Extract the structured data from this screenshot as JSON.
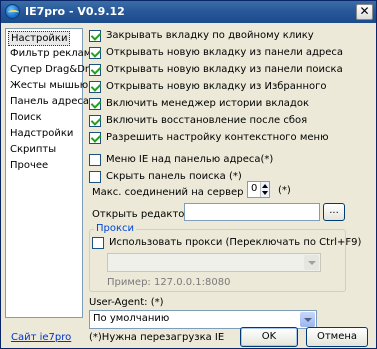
{
  "window": {
    "title": "IE7pro - V0.9.12",
    "close_symbol": "✕"
  },
  "sidebar": {
    "items": [
      {
        "label": "Настройки",
        "selected": true
      },
      {
        "label": "Фильтр рекламы"
      },
      {
        "label": "Супер Drag&Drop"
      },
      {
        "label": "Жесты мышью"
      },
      {
        "label": "Панель адреса"
      },
      {
        "label": "Поиск"
      },
      {
        "label": "Надстройки"
      },
      {
        "label": "Скрипты"
      },
      {
        "label": "Прочее"
      }
    ]
  },
  "options": {
    "close_dblclick": "Закрывать вкладку по двойному клику",
    "new_tab_address": "Открывать новую вкладку из панели адреса",
    "new_tab_search": "Открывать новую вкладку из панели поиска",
    "new_tab_favorites": "Открывать новую вкладку из Избранного",
    "history_manager": "Включить менеджер истории вкладок",
    "crash_recovery": "Включить восстановление после сбоя",
    "context_menu": "Разрешить настройку контекстного меню",
    "ie_menu_above": "Меню IE над панелью адреса(*)",
    "hide_search": "Скрыть панель поиска (*)"
  },
  "connections": {
    "label": "Макс. соединений на сервер",
    "value": "0",
    "suffix": "(*)"
  },
  "editor": {
    "label": "Открыть редактор",
    "value": "",
    "browse": "..."
  },
  "proxy": {
    "group_label": "Прокси",
    "use_proxy": "Использовать прокси (Переключать по Ctrl+F9)",
    "selected": "",
    "example": "Пример: 127.0.0.1:8080"
  },
  "user_agent": {
    "label": "User-Agent: (*)",
    "selected": "По умолчанию"
  },
  "footer": {
    "site_link": "Сайт ie7pro",
    "note": "(*)Нужна перезагрузка IE",
    "ok": "OK",
    "cancel": "Отмена"
  }
}
